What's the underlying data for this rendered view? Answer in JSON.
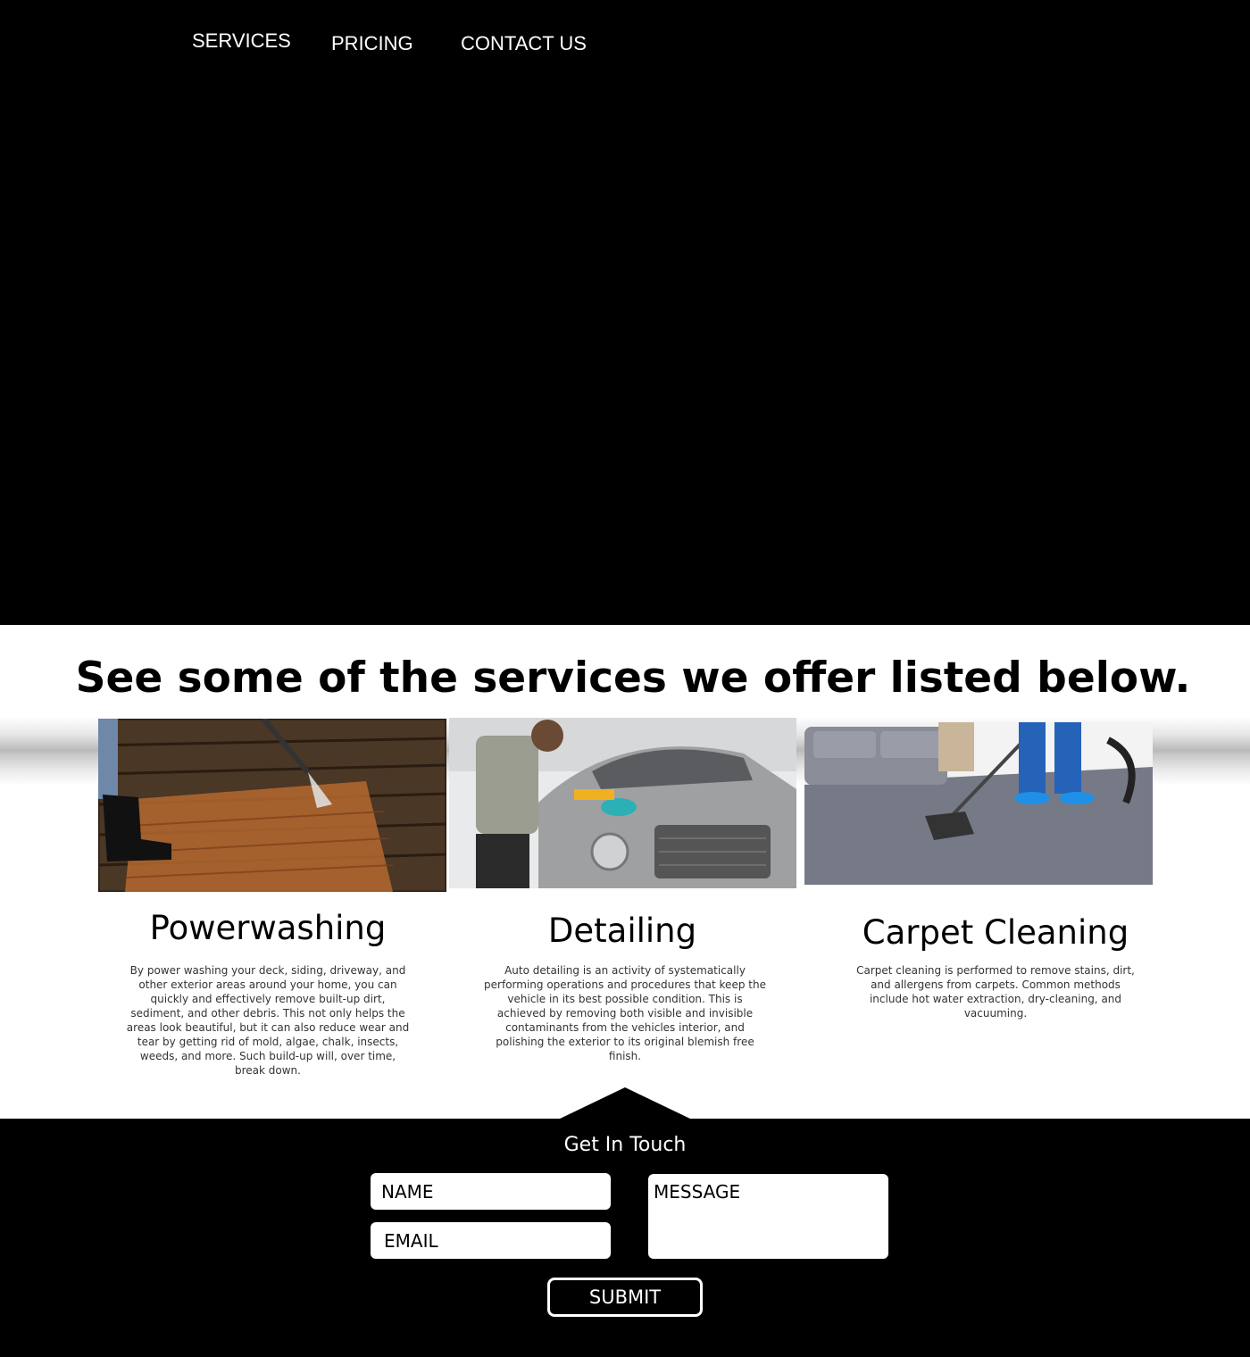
{
  "nav": {
    "services_label": "SERVICES",
    "pricing_label": "PRICING",
    "contact_label": "CONTACT US"
  },
  "services": {
    "heading": "See some of the services we offer listed below.",
    "items": [
      {
        "title": "Powerwashing",
        "description": "By power washing your deck, siding, driveway, and other exterior areas around your home, you can quickly and effectively remove built-up dirt, sediment, and other debris. This not only helps the areas look beautiful, but it can also reduce wear and tear by getting rid of mold, algae, chalk, insects, weeds, and more. Such build-up will, over time, break down."
      },
      {
        "title": "Detailing",
        "description": "Auto detailing is an activity of systematically performing operations and procedures that keep the vehicle in its best possible condition. This is achieved by removing both visible and invisible contaminants from the vehicles interior, and polishing the exterior to its original blemish free finish."
      },
      {
        "title": "Carpet Cleaning",
        "description": "Carpet cleaning is performed to remove stains, dirt, and allergens from carpets. Common methods include hot water extraction, dry-cleaning, and vacuuming."
      }
    ]
  },
  "contact": {
    "title": "Get In Touch",
    "name_placeholder": "NAME",
    "email_placeholder": "EMAIL",
    "message_placeholder": "MESSAGE",
    "submit_label": "SUBMIT"
  },
  "colors": {
    "background": "#000000",
    "section_bg": "#ffffff",
    "text_light": "#ffffff",
    "text_dark": "#000000"
  }
}
